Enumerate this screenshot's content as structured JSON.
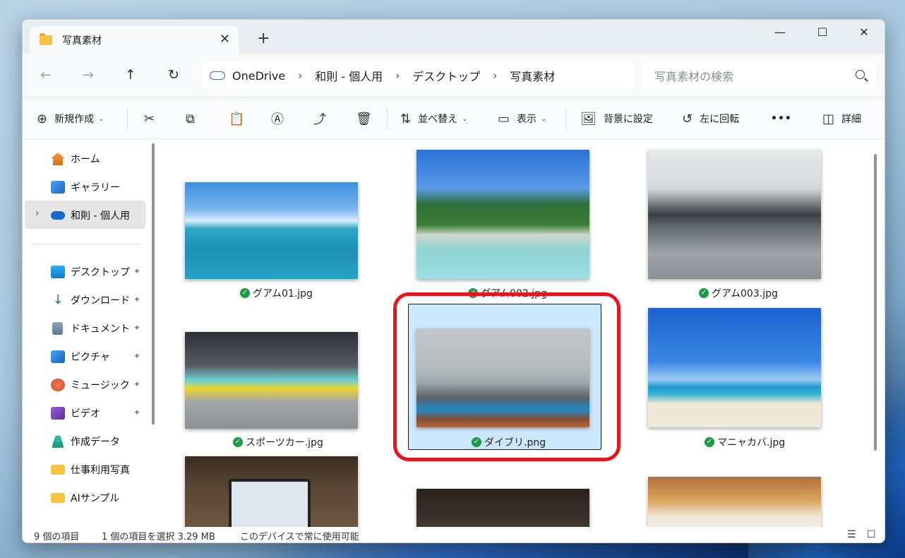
{
  "window": {
    "tab_title": "写真素材",
    "close_glyph": "✕",
    "new_tab_glyph": "+",
    "minimize": "—",
    "maximize": "☐",
    "close": "✕"
  },
  "address": {
    "crumbs": [
      "OneDrive",
      "和則 - 個人用",
      "デスクトップ",
      "写真素材"
    ],
    "separator": "›",
    "search_placeholder": "写真素材の検索",
    "back": "←",
    "forward": "→",
    "up": "↑",
    "refresh": "↻"
  },
  "toolbar": {
    "new_label": "新規作成",
    "sort_label": "並べ替え",
    "view_label": "表示",
    "background_label": "背景に設定",
    "rotate_label": "左に回転",
    "more_label": "•••",
    "details_label": "詳細"
  },
  "sidebar": {
    "items": [
      {
        "label": "ホーム",
        "icon": "home-icon"
      },
      {
        "label": "ギャラリー",
        "icon": "gallery-icon"
      },
      {
        "label": "和則 - 個人用",
        "icon": "cloud-icon"
      },
      {
        "label": "デスクトップ",
        "icon": "desktop-icon",
        "pinned": true
      },
      {
        "label": "ダウンロード",
        "icon": "download-icon",
        "pinned": true
      },
      {
        "label": "ドキュメント",
        "icon": "document-icon",
        "pinned": true
      },
      {
        "label": "ピクチャ",
        "icon": "pictures-icon",
        "pinned": true
      },
      {
        "label": "ミュージック",
        "icon": "music-icon",
        "pinned": true
      },
      {
        "label": "ビデオ",
        "icon": "video-icon",
        "pinned": true
      },
      {
        "label": "作成データ",
        "icon": "user-icon"
      },
      {
        "label": "仕事利用写真",
        "icon": "folder-icon"
      },
      {
        "label": "AIサンプル",
        "icon": "folder-icon"
      }
    ],
    "expand_glyph": "›",
    "pin_glyph": "📌"
  },
  "files": [
    {
      "name": "グアム01.jpg"
    },
    {
      "name": "グアム002.jpg"
    },
    {
      "name": "グアム003.jpg"
    },
    {
      "name": "スポーツカー.jpg"
    },
    {
      "name": "ダイブリ.png",
      "selected": true
    },
    {
      "name": "マニャカバ.jpg"
    }
  ],
  "status": {
    "count": "9 個の項目",
    "selection": "1 個の項目を選択  3.29 MB",
    "availability": "このデバイスで常に使用可能"
  },
  "colors": {
    "accent": "#0078d4",
    "selection": "#cce8ff",
    "highlight_ring": "#e8141b",
    "sync_ok": "#1d9a43"
  }
}
